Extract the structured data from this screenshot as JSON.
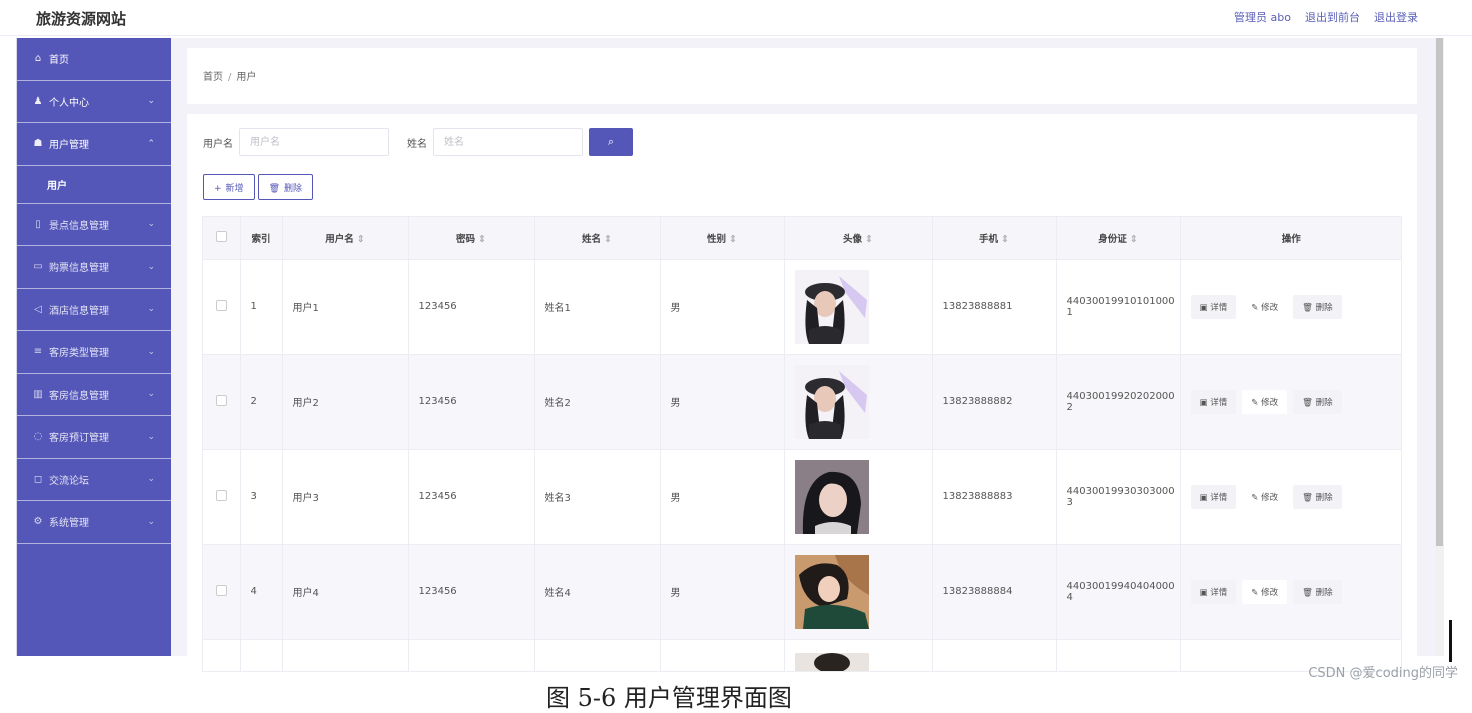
{
  "header": {
    "brand": "旅游资源网站",
    "links": [
      "管理员 abo",
      "退出到前台",
      "退出登录"
    ]
  },
  "sidebar": {
    "items": [
      {
        "label": "首页",
        "icon": "home-icon",
        "glyph": "⌂",
        "chevron": ""
      },
      {
        "label": "个人中心",
        "icon": "user-icon",
        "glyph": "♟",
        "chevron": "⌄"
      },
      {
        "label": "用户管理",
        "icon": "users-icon",
        "glyph": "☗",
        "chevron": "⌃"
      },
      {
        "label": "景点信息管理",
        "icon": "phone-icon",
        "glyph": "▯",
        "chevron": "⌄"
      },
      {
        "label": "购票信息管理",
        "icon": "ticket-icon",
        "glyph": "▭",
        "chevron": "⌄"
      },
      {
        "label": "酒店信息管理",
        "icon": "send-icon",
        "glyph": "◁",
        "chevron": "⌄"
      },
      {
        "label": "客房类型管理",
        "icon": "list-icon",
        "glyph": "≡",
        "chevron": "⌄"
      },
      {
        "label": "客房信息管理",
        "icon": "trash-icon",
        "glyph": "▥",
        "chevron": "⌄"
      },
      {
        "label": "客房预订管理",
        "icon": "clock-icon",
        "glyph": "◌",
        "chevron": "⌄"
      },
      {
        "label": "交流论坛",
        "icon": "chat-icon",
        "glyph": "◻",
        "chevron": "⌄"
      },
      {
        "label": "系统管理",
        "icon": "settings-icon",
        "glyph": "⚙",
        "chevron": "⌄"
      }
    ],
    "submenu_label": "用户"
  },
  "breadcrumb": {
    "home": "首页",
    "separator": "/",
    "current": "用户"
  },
  "search": {
    "username_label": "用户名",
    "username_placeholder": "用户名",
    "name_label": "姓名",
    "name_placeholder": "姓名",
    "search_icon": "⌕"
  },
  "actions": {
    "add_label": "新增",
    "add_icon": "+",
    "delete_label": "删除",
    "delete_icon": "🗑"
  },
  "table": {
    "columns": [
      "索引",
      "用户名",
      "密码",
      "姓名",
      "性别",
      "头像",
      "手机",
      "身份证",
      "操作"
    ],
    "sort_glyph": "⇕",
    "rows": [
      {
        "index": "1",
        "username": "用户1",
        "password": "123456",
        "name": "姓名1",
        "gender": "男",
        "phone": "13823888881",
        "idcard": "44030019910101000",
        "idcard_tail": "1"
      },
      {
        "index": "2",
        "username": "用户2",
        "password": "123456",
        "name": "姓名2",
        "gender": "男",
        "phone": "13823888882",
        "idcard": "44030019920202000",
        "idcard_tail": "2"
      },
      {
        "index": "3",
        "username": "用户3",
        "password": "123456",
        "name": "姓名3",
        "gender": "男",
        "phone": "13823888883",
        "idcard": "44030019930303000",
        "idcard_tail": "3"
      },
      {
        "index": "4",
        "username": "用户4",
        "password": "123456",
        "name": "姓名4",
        "gender": "男",
        "phone": "13823888884",
        "idcard": "44030019940404000",
        "idcard_tail": "4"
      }
    ],
    "op_labels": {
      "detail": "详情",
      "edit": "修改",
      "delete": "删除"
    }
  },
  "watermark": "CSDN @爱coding的同学",
  "caption": "图 5-6 用户管理界面图",
  "colors": {
    "primary": "#5456b8",
    "background": "#f2f2f8"
  }
}
